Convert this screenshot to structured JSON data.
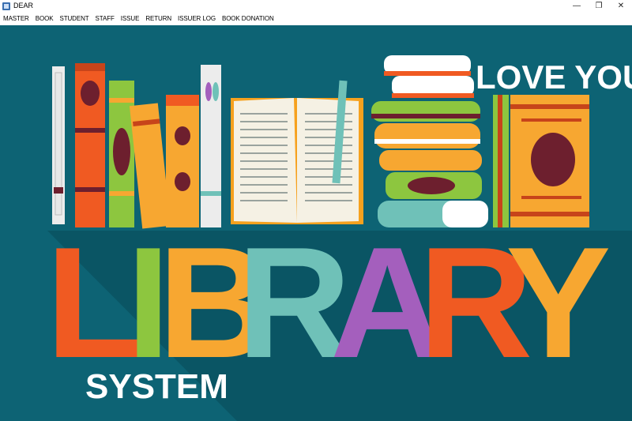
{
  "window": {
    "title": "DEAR",
    "controls": {
      "minimize": "—",
      "restore": "❐",
      "close": "✕"
    }
  },
  "menu": {
    "items": [
      "MASTER",
      "BOOK",
      "STUDENT",
      "STAFF",
      "ISSUE",
      "RETURN",
      "ISSUER LOG",
      "BOOK DONATION"
    ]
  },
  "banner": {
    "tagline": "LOVE YOUR",
    "headline_letters": [
      "L",
      "I",
      "B",
      "R",
      "A",
      "R",
      "Y"
    ],
    "subtitle": "SYSTEM",
    "colors": {
      "background": "#0d6374",
      "L": "#f05a22",
      "I": "#8dc63f",
      "B": "#f7a731",
      "R1": "#6fc1b8",
      "A": "#a45fbd",
      "R2": "#f05a22",
      "Y": "#f7a731"
    }
  }
}
